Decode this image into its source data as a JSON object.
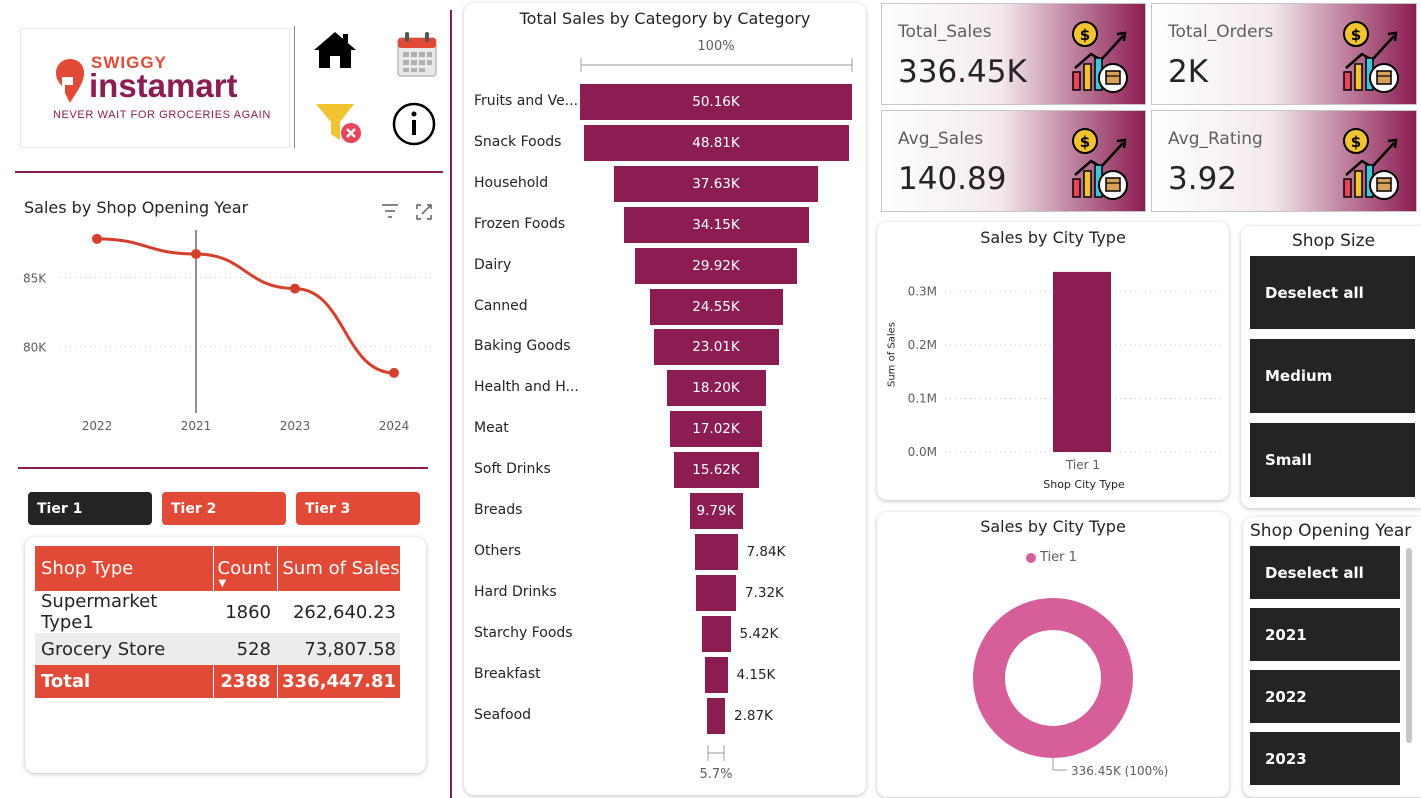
{
  "logo": {
    "brand_top": "SWIGGY",
    "brand_main": "instamart",
    "tagline": "NEVER WAIT FOR GROCERIES AGAIN"
  },
  "nav_icons": [
    "home-icon",
    "calendar-icon",
    "clear-filter-icon",
    "info-icon"
  ],
  "line_chart": {
    "title": "Sales by Shop Opening Year",
    "chart_data": {
      "type": "line",
      "categories": [
        "2022",
        "2021",
        "2023",
        "2024"
      ],
      "values": [
        87800,
        86700,
        84200,
        78100
      ],
      "yticks": [
        {
          "label": "85K",
          "value": 85000
        },
        {
          "label": "80K",
          "value": 80000
        }
      ],
      "ylim": [
        76500,
        88800
      ],
      "grid": true
    }
  },
  "tiers": {
    "items": [
      {
        "label": "Tier 1",
        "selected": true
      },
      {
        "label": "Tier 2",
        "selected": false
      },
      {
        "label": "Tier 3",
        "selected": false
      }
    ]
  },
  "matrix": {
    "headers": [
      "Shop Type",
      "Count",
      "Sum of Sales"
    ],
    "rows": [
      {
        "type": "Supermarket Type1",
        "count": "1860",
        "sales": "262,640.23"
      },
      {
        "type": "Grocery Store",
        "count": "528",
        "sales": "73,807.58"
      }
    ],
    "total": {
      "type": "Total",
      "count": "2388",
      "sales": "336,447.81"
    }
  },
  "funnel": {
    "title": "Total Sales by Category by Category",
    "top_pct": "100%",
    "bottom_pct": "5.7%",
    "chart_data": {
      "type": "bar",
      "orientation": "funnel",
      "categories": [
        "Fruits and Ve...",
        "Snack Foods",
        "Household",
        "Frozen Foods",
        "Dairy",
        "Canned",
        "Baking Goods",
        "Health and H...",
        "Meat",
        "Soft Drinks",
        "Breads",
        "Others",
        "Hard Drinks",
        "Starchy Foods",
        "Breakfast",
        "Seafood"
      ],
      "values": [
        50160,
        48810,
        37630,
        34150,
        29920,
        24550,
        23010,
        18200,
        17020,
        15620,
        9790,
        7840,
        7320,
        5420,
        4150,
        2870
      ],
      "labels": [
        "50.16K",
        "48.81K",
        "37.63K",
        "34.15K",
        "29.92K",
        "24.55K",
        "23.01K",
        "18.20K",
        "17.02K",
        "15.62K",
        "9.79K",
        "7.84K",
        "7.32K",
        "5.42K",
        "4.15K",
        "2.87K"
      ]
    }
  },
  "kpis": [
    {
      "label": "Total_Sales",
      "value": "336.45K"
    },
    {
      "label": "Total_Orders",
      "value": "2K"
    },
    {
      "label": "Avg_Sales",
      "value": "140.89"
    },
    {
      "label": "Avg_Rating",
      "value": "3.92"
    }
  ],
  "city_bar": {
    "title": "Sales by City Type",
    "xlabel": "Shop City Type",
    "ylabel": "Sum of Sales",
    "chart_data": {
      "type": "bar",
      "categories": [
        "Tier 1"
      ],
      "values": [
        336447.81
      ],
      "yticks": [
        {
          "label": "0.3M",
          "value": 300000
        },
        {
          "label": "0.2M",
          "value": 200000
        },
        {
          "label": "0.1M",
          "value": 100000
        },
        {
          "label": "0.0M",
          "value": 0
        }
      ],
      "ylim": [
        0,
        340000
      ]
    }
  },
  "city_donut": {
    "title": "Sales by City Type",
    "legend": "Tier 1",
    "data_label": "336.45K (100%)",
    "chart_data": {
      "type": "pie",
      "categories": [
        "Tier 1"
      ],
      "values": [
        336447.81
      ]
    }
  },
  "shop_size": {
    "title": "Shop Size",
    "items": [
      "Deselect all",
      "Medium",
      "Small"
    ]
  },
  "opening_year": {
    "title": "Shop Opening Year",
    "items": [
      "Deselect all",
      "2021",
      "2022",
      "2023"
    ]
  },
  "colors": {
    "brand": "#8b1d52",
    "accent_orange": "#e14a36",
    "line": "#d5402b",
    "donut": "#d65f9a",
    "slicer": "#252423"
  }
}
